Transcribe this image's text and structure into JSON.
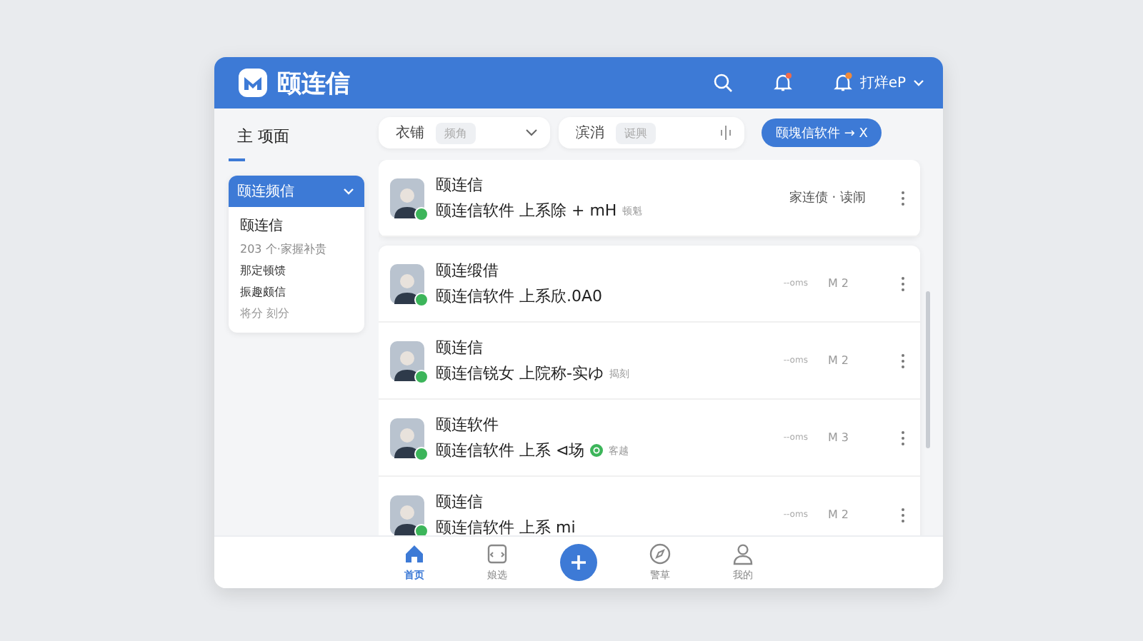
{
  "header": {
    "app_name": "颐连信",
    "user_name": "打烊eP",
    "notification_dot": true
  },
  "page_tab": {
    "label": "主 项面",
    "selected": true
  },
  "filters": [
    {
      "label": "衣铺",
      "chip": "频角",
      "kind": "dropdown"
    },
    {
      "label": "滨消",
      "chip": "诞興",
      "kind": "adjust"
    }
  ],
  "action_button": {
    "label": "颐塊信软件 → X"
  },
  "sidebar": {
    "dropdown": "颐连频信",
    "items": [
      {
        "text": "颐连信",
        "kind": "title"
      },
      {
        "text": "203 个·家握补贵",
        "kind": "sub"
      },
      {
        "text": "那定顿馈",
        "kind": "item"
      },
      {
        "text": "振趣颇信",
        "kind": "item"
      },
      {
        "text": "将分 刻分",
        "kind": "muted"
      }
    ]
  },
  "conversations": [
    {
      "name": "颐连信",
      "message": "颐连信软件 上系除 + mH",
      "tag": "顿魁",
      "status": "家连债 · 读闹",
      "online": true,
      "pinned": true
    },
    {
      "name": "颐连缎借",
      "message": "颐连信软件 上系欣.0A0",
      "time": "--oms",
      "count": "M 2",
      "online": true,
      "pinned": false
    },
    {
      "name": "颐连信",
      "message": "颐连信锐女 上院称-实ゆ",
      "tag": "揭刻",
      "time": "--oms",
      "count": "M 2",
      "online": true,
      "pinned": false
    },
    {
      "name": "颐连软件",
      "message": "颐连信软件 上系 ⊲场",
      "badge": true,
      "tag": "客越",
      "time": "--oms",
      "count": "M 3",
      "online": true,
      "pinned": false
    },
    {
      "name": "颐连信",
      "message": "颐连信软件 上系 mi",
      "time": "--oms",
      "count": "M 2",
      "online": true,
      "pinned": false
    }
  ],
  "bottom_nav": [
    {
      "label": "首页",
      "kind": "tab",
      "selected": true
    },
    {
      "label": "娘选",
      "kind": "tab",
      "selected": false
    },
    {
      "kind": "fab"
    },
    {
      "label": "警草",
      "kind": "tab",
      "selected": false
    },
    {
      "label": "我的",
      "kind": "tab",
      "selected": false
    }
  ]
}
